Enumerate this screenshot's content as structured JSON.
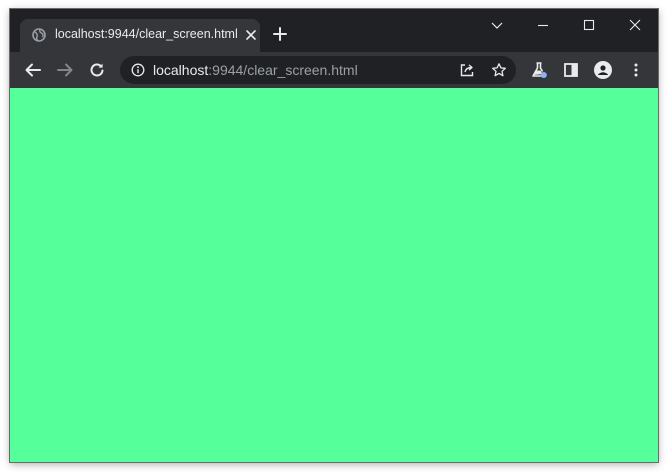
{
  "tab": {
    "title": "localhost:9944/clear_screen.html",
    "favicon": "globe-icon"
  },
  "address_bar": {
    "host": "localhost",
    "path": ":9944/clear_screen.html"
  },
  "icons": {
    "new_tab": "plus-icon",
    "tab_search": "chevron-down-icon",
    "minimize": "minimize-icon",
    "maximize": "maximize-icon",
    "close": "close-icon",
    "back": "back-arrow-icon",
    "forward": "forward-arrow-icon",
    "reload": "reload-icon",
    "site_info": "info-icon",
    "share": "share-icon",
    "bookmark": "star-icon",
    "labs": "flask-icon",
    "side_panel": "side-panel-icon",
    "profile": "profile-icon",
    "menu": "kebab-menu-icon"
  },
  "colors": {
    "page_background": "#55ff99",
    "frame": "#202124",
    "toolbar": "#35363a"
  }
}
